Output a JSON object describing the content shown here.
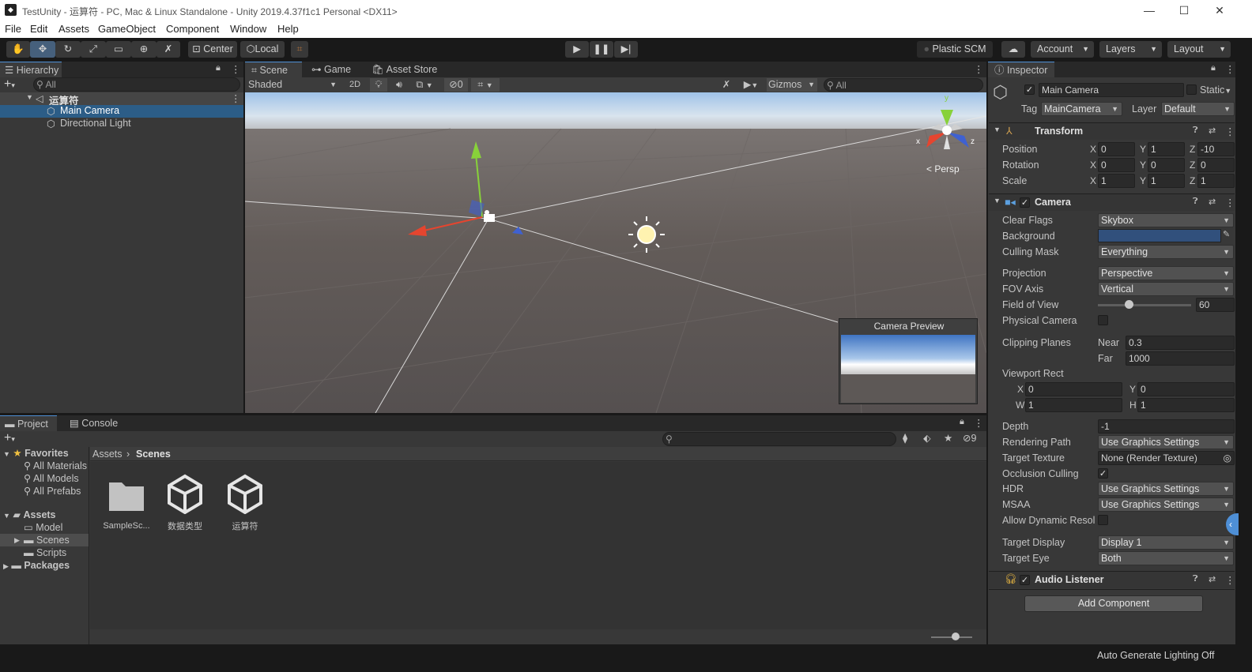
{
  "window": {
    "title": "TestUnity - 运算符 - PC, Mac & Linux Standalone - Unity 2019.4.37f1c1 Personal <DX11>",
    "minimize": "—",
    "maximize": "☐",
    "close": "✕"
  },
  "menu": [
    "File",
    "Edit",
    "Assets",
    "GameObject",
    "Component",
    "Window",
    "Help"
  ],
  "toolbar": {
    "center": "Center",
    "local": "Local",
    "plastic": "Plastic SCM",
    "account": "Account",
    "layers": "Layers",
    "layout": "Layout"
  },
  "hierarchy": {
    "tab": "Hierarchy",
    "search_placeholder": "All",
    "scene": "运算符",
    "items": [
      "Main Camera",
      "Directional Light"
    ]
  },
  "scene": {
    "tabs": [
      "Scene",
      "Game",
      "Asset Store"
    ],
    "shading": "Shaded",
    "mode2d": "2D",
    "hidden_count": "0",
    "gizmos": "Gizmos",
    "search_placeholder": "All",
    "persp": "Persp",
    "axis_x": "x",
    "axis_z": "z",
    "axis_y": "y",
    "camera_preview": "Camera Preview"
  },
  "project": {
    "tabs": [
      "Project",
      "Console"
    ],
    "hidden_count": "9",
    "favorites": "Favorites",
    "favorite_items": [
      "All Materials",
      "All Models",
      "All Prefabs"
    ],
    "assets": "Assets",
    "asset_folders": [
      "Model",
      "Scenes",
      "Scripts"
    ],
    "packages": "Packages",
    "breadcrumb": [
      "Assets",
      "Scenes"
    ],
    "files": [
      "SampleSc...",
      "数据类型",
      "运算符"
    ]
  },
  "inspector": {
    "tab": "Inspector",
    "object_name": "Main Camera",
    "static": "Static",
    "tag_label": "Tag",
    "tag": "MainCamera",
    "layer_label": "Layer",
    "layer": "Default",
    "transform": {
      "title": "Transform",
      "labels": [
        "Position",
        "Rotation",
        "Scale"
      ],
      "axes": [
        "X",
        "Y",
        "Z"
      ],
      "position": [
        "0",
        "1",
        "-10"
      ],
      "rotation": [
        "0",
        "0",
        "0"
      ],
      "scale": [
        "1",
        "1",
        "1"
      ]
    },
    "camera": {
      "title": "Camera",
      "clear_flags_label": "Clear Flags",
      "clear_flags": "Skybox",
      "background_label": "Background",
      "background_color": "#31507c",
      "culling_mask_label": "Culling Mask",
      "culling_mask": "Everything",
      "projection_label": "Projection",
      "projection": "Perspective",
      "fov_axis_label": "FOV Axis",
      "fov_axis": "Vertical",
      "fov_label": "Field of View",
      "fov": "60",
      "fov_fraction": 0.33,
      "physical_label": "Physical Camera",
      "clipping_label": "Clipping Planes",
      "near_label": "Near",
      "near": "0.3",
      "far_label": "Far",
      "far": "1000",
      "viewport_label": "Viewport Rect",
      "vx_label": "X",
      "vx": "0",
      "vy_label": "Y",
      "vy": "0",
      "vw_label": "W",
      "vw": "1",
      "vh_label": "H",
      "vh": "1",
      "depth_label": "Depth",
      "depth": "-1",
      "rendering_path_label": "Rendering Path",
      "rendering_path": "Use Graphics Settings",
      "target_texture_label": "Target Texture",
      "target_texture": "None (Render Texture)",
      "occlusion_label": "Occlusion Culling",
      "hdr_label": "HDR",
      "hdr": "Use Graphics Settings",
      "msaa_label": "MSAA",
      "msaa": "Use Graphics Settings",
      "dynamic_res_label": "Allow Dynamic Resol",
      "target_display_label": "Target Display",
      "target_display": "Display 1",
      "target_eye_label": "Target Eye",
      "target_eye": "Both"
    },
    "audio_listener": "Audio Listener",
    "add_component": "Add Component"
  },
  "status": {
    "lighting": "Auto Generate Lighting Off"
  },
  "colors": {
    "accent": "#4e8fd6",
    "selection": "#2c5d87",
    "panel": "#383838"
  }
}
